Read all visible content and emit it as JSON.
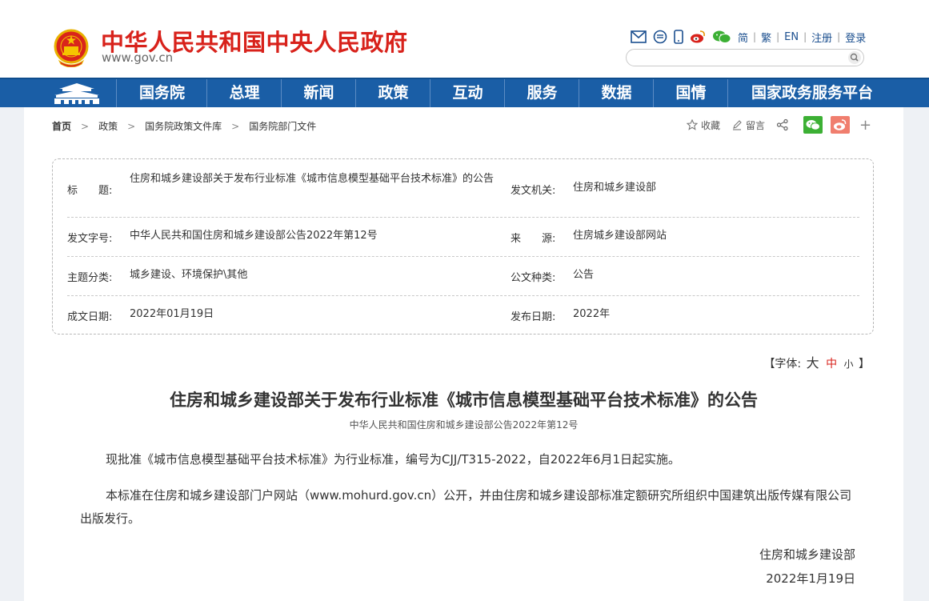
{
  "header": {
    "site_title": "中华人民共和国中央人民政府",
    "site_domain": "www.gov.cn",
    "languages": [
      "简",
      "繁",
      "EN",
      "注册",
      "登录"
    ],
    "search_placeholder": ""
  },
  "nav": {
    "items": [
      "国务院",
      "总理",
      "新闻",
      "政策",
      "互动",
      "服务",
      "数据",
      "国情",
      "国家政务服务平台"
    ]
  },
  "breadcrumb": [
    "首页",
    "政策",
    "国务院政策文件库",
    "国务院部门文件"
  ],
  "share": {
    "favorite": "收藏",
    "comment": "留言"
  },
  "info": {
    "title_label": "标　　题:",
    "title_value": "住房和城乡建设部关于发布行业标准《城市信息模型基础平台技术标准》的公告",
    "issuer_label": "发文机关:",
    "issuer_value": "住房和城乡建设部",
    "docno_label": "发文字号:",
    "docno_value": "中华人民共和国住房和城乡建设部公告2022年第12号",
    "source_label": "来　　源:",
    "source_value": "住房城乡建设部网站",
    "topic_label": "主题分类:",
    "topic_value": "城乡建设、环境保护\\其他",
    "type_label": "公文种类:",
    "type_value": "公告",
    "created_label": "成文日期:",
    "created_value": "2022年01月19日",
    "published_label": "发布日期:",
    "published_value": "2022年"
  },
  "fontsize": {
    "open": "【字体:",
    "large": "大",
    "medium": "中",
    "small": "小",
    "close": "】"
  },
  "article": {
    "title": "住房和城乡建设部关于发布行业标准《城市信息模型基础平台技术标准》的公告",
    "doc_number": "中华人民共和国住房和城乡建设部公告2022年第12号",
    "paragraphs": [
      "现批准《城市信息模型基础平台技术标准》为行业标准，编号为CJJ/T315-2022，自2022年6月1日起实施。",
      "本标准在住房和城乡建设部门户网站（www.mohurd.gov.cn）公开，并由住房和城乡建设部标准定额研究所组织中国建筑出版传媒有限公司出版发行。"
    ],
    "signer": "住房和城乡建设部",
    "date": "2022年1月19日"
  },
  "colors": {
    "brand_red": "#d8221b",
    "nav_blue": "#1a5ea6",
    "wechat_green": "#3cb034",
    "weibo_orange": "#f07e6e"
  },
  "icons": [
    "national-emblem-icon",
    "mail-icon",
    "message-icon",
    "mobile-icon",
    "weibo-icon",
    "wechat-icon",
    "search-icon",
    "tiananmen-icon",
    "star-icon",
    "pen-icon",
    "share-icon",
    "plus-icon"
  ]
}
